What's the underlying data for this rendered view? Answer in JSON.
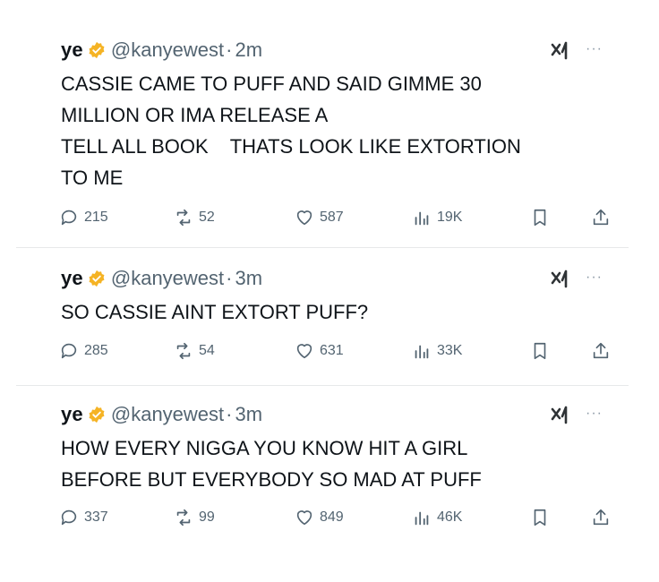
{
  "colors": {
    "text": "#0f1419",
    "secondary": "#536471",
    "badge": "#f5b324",
    "divider": "#e7e9ea"
  },
  "tweets": [
    {
      "name": "ye",
      "handle": "@kanyewest",
      "dot": "·",
      "time": "2m",
      "text": "CASSIE CAME TO PUFF AND SAID GIMME 30\nMILLION OR IMA RELEASE A\nTELL ALL BOOK    THATS LOOK LIKE EXTORTION\nTO ME",
      "replies": "215",
      "reposts": "52",
      "likes": "587",
      "views": "19K"
    },
    {
      "name": "ye",
      "handle": "@kanyewest",
      "dot": "·",
      "time": "3m",
      "text": "SO CASSIE AINT EXTORT PUFF?",
      "replies": "285",
      "reposts": "54",
      "likes": "631",
      "views": "33K"
    },
    {
      "name": "ye",
      "handle": "@kanyewest",
      "dot": "·",
      "time": "3m",
      "text": "HOW EVERY NIGGA YOU KNOW HIT A GIRL\nBEFORE BUT EVERYBODY SO MAD AT PUFF",
      "replies": "337",
      "reposts": "99",
      "likes": "849",
      "views": "46K"
    }
  ],
  "icons": {
    "verified": "verified-badge-icon",
    "grok": "xai-grok-icon",
    "more": "more-icon",
    "reply": "reply-icon",
    "repost": "repost-icon",
    "like": "heart-icon",
    "views": "views-icon",
    "bookmark": "bookmark-icon",
    "share": "share-icon"
  },
  "more_label": "···"
}
